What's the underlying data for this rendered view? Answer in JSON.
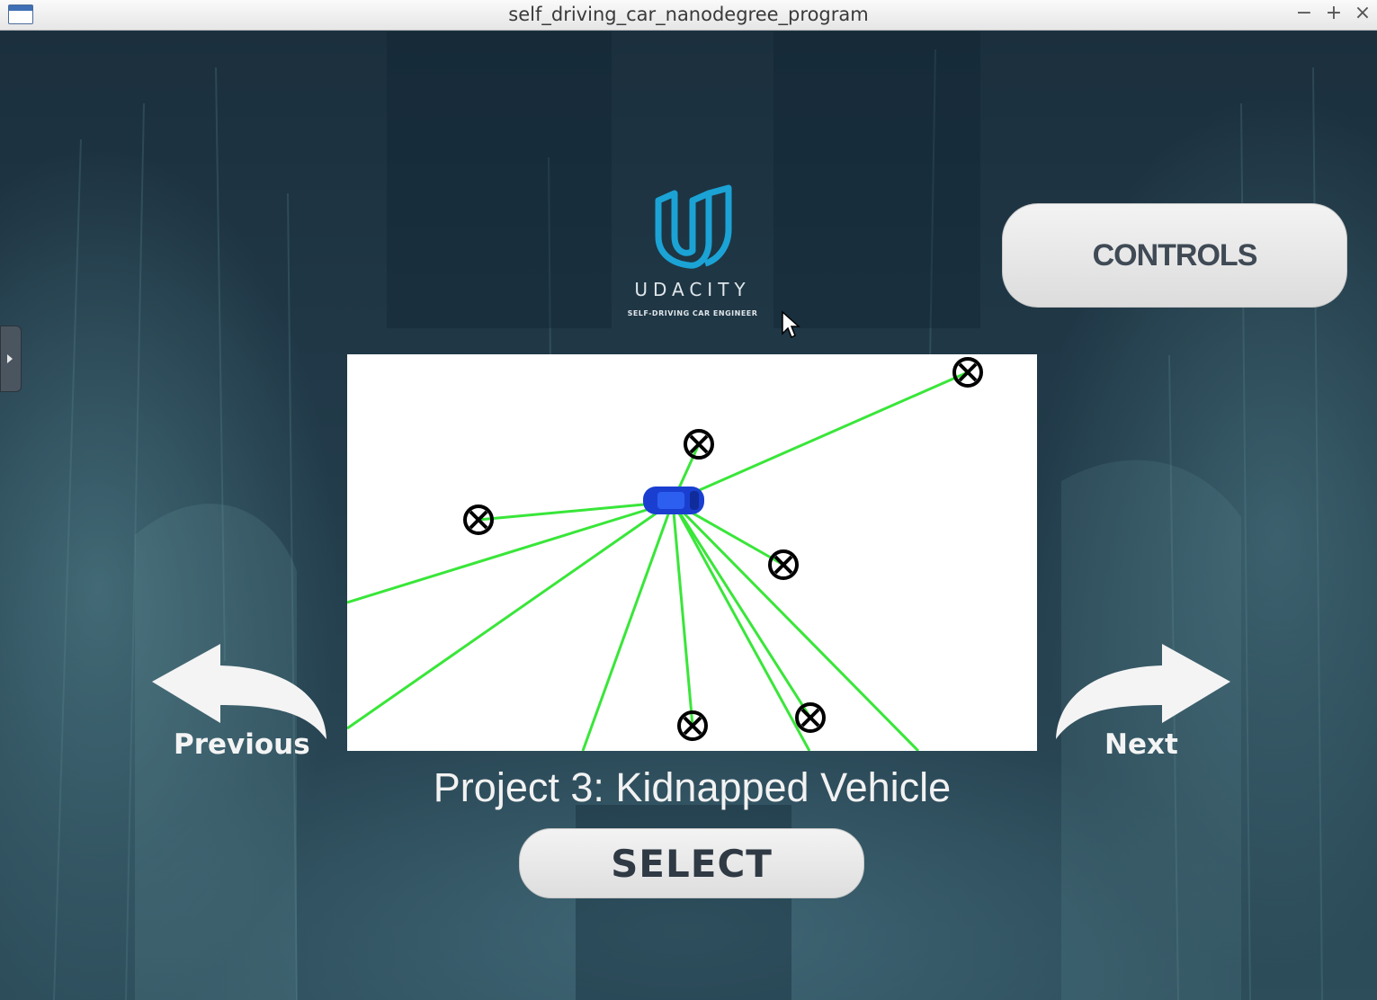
{
  "window": {
    "title": "self_driving_car_nanodegree_program",
    "minimize": "−",
    "maximize": "+",
    "close": "×"
  },
  "logo": {
    "brand": "UDACITY",
    "tagline": "SELF-DRIVING CAR ENGINEER",
    "color": "#1ba3d6"
  },
  "controls_button": {
    "label": "CONTROLS"
  },
  "navigation": {
    "previous_label": "Previous",
    "next_label": "Next"
  },
  "project": {
    "title": "Project 3: Kidnapped Vehicle",
    "select_label": "SELECT"
  },
  "colors": {
    "laser_lines": "#39e639",
    "vehicle": "#1a3fd0",
    "landmark": "#000000"
  }
}
